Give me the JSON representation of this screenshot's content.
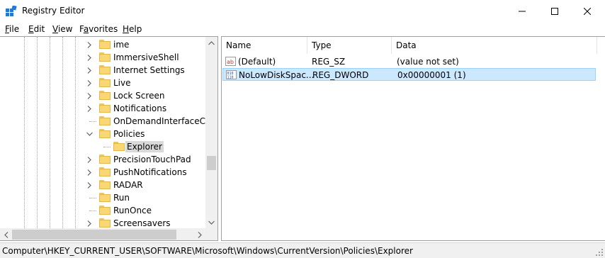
{
  "window": {
    "title": "Registry Editor",
    "icon": "registry-icon",
    "controls": [
      "minimize-icon",
      "maximize-icon",
      "close-icon"
    ]
  },
  "menu": {
    "file": {
      "accel": "F",
      "rest": "ile"
    },
    "edit": {
      "accel": "E",
      "rest": "dit"
    },
    "view": {
      "accel": "V",
      "rest": "iew"
    },
    "favorites": {
      "pre": "F",
      "accel": "a",
      "rest": "vorites"
    },
    "help": {
      "accel": "H",
      "rest": "elp"
    }
  },
  "tree": {
    "nodes": [
      {
        "label": "ime",
        "expander": "collapsed"
      },
      {
        "label": "ImmersiveShell",
        "expander": "collapsed"
      },
      {
        "label": "Internet Settings",
        "expander": "collapsed"
      },
      {
        "label": "Live",
        "expander": "collapsed"
      },
      {
        "label": "Lock Screen",
        "expander": "collapsed"
      },
      {
        "label": "Notifications",
        "expander": "collapsed"
      },
      {
        "label": "OnDemandInterfaceCac",
        "expander": "none"
      },
      {
        "label": "Policies",
        "expander": "expanded"
      },
      {
        "label": "Explorer",
        "expander": "none",
        "child": true,
        "selected": true
      },
      {
        "label": "PrecisionTouchPad",
        "expander": "collapsed"
      },
      {
        "label": "PushNotifications",
        "expander": "collapsed"
      },
      {
        "label": "RADAR",
        "expander": "collapsed"
      },
      {
        "label": "Run",
        "expander": "none"
      },
      {
        "label": "RunOnce",
        "expander": "none"
      },
      {
        "label": "Screensavers",
        "expander": "collapsed"
      }
    ]
  },
  "list": {
    "columns": [
      "Name",
      "Type",
      "Data"
    ],
    "rows": [
      {
        "icon": "string-value-icon",
        "name": "(Default)",
        "type": "REG_SZ",
        "data": "(value not set)",
        "selected": false
      },
      {
        "icon": "binary-value-icon",
        "name": "NoLowDiskSpac...",
        "type": "REG_DWORD",
        "data": "0x00000001 (1)",
        "selected": true
      }
    ]
  },
  "status": {
    "path": "Computer\\HKEY_CURRENT_USER\\SOFTWARE\\Microsoft\\Windows\\CurrentVersion\\Policies\\Explorer"
  },
  "colors": {
    "selection_bg": "#cce8ff",
    "selection_border": "#99d1ff",
    "folder": "#f8d775",
    "statusbar": "#f0f0f0"
  }
}
